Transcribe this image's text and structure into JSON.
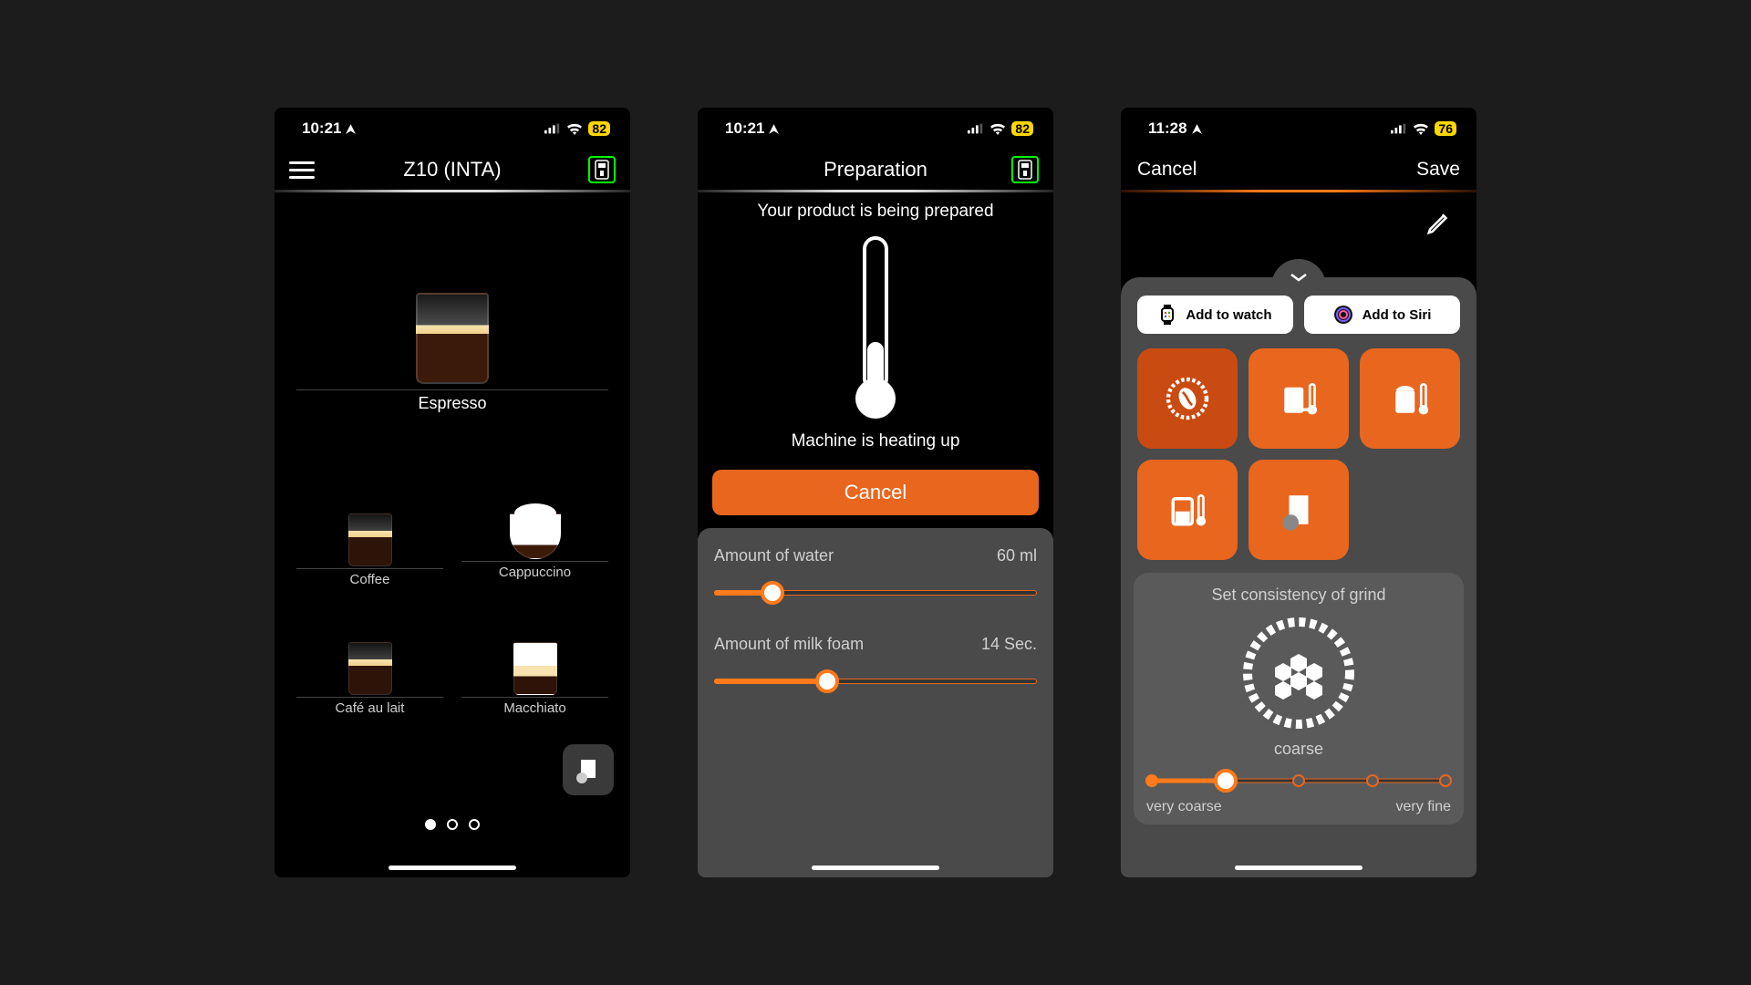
{
  "screen1": {
    "status": {
      "time": "10:21",
      "battery": "82"
    },
    "title": "Z10 (INTA)",
    "hero_label": "Espresso",
    "items": [
      {
        "label": "Coffee"
      },
      {
        "label": "Cappuccino"
      },
      {
        "label": "Café au lait"
      },
      {
        "label": "Macchiato"
      }
    ],
    "page_index": 0,
    "page_count": 3
  },
  "screen2": {
    "status": {
      "time": "10:21",
      "battery": "82"
    },
    "title": "Preparation",
    "message": "Your product is being prepared",
    "status_text": "Machine is heating up",
    "cancel_label": "Cancel",
    "params": [
      {
        "label": "Amount of water",
        "value": "60 ml",
        "percent": 18
      },
      {
        "label": "Amount of milk foam",
        "value": "14 Sec.",
        "percent": 35
      }
    ]
  },
  "screen3": {
    "status": {
      "time": "11:28",
      "battery": "76"
    },
    "cancel": "Cancel",
    "save": "Save",
    "add_watch": "Add to watch",
    "add_siri": "Add to Siri",
    "grind": {
      "title": "Set consistency of grind",
      "value": "coarse",
      "min_label": "very coarse",
      "max_label": "very fine",
      "stops": 5,
      "selected": 1
    }
  }
}
